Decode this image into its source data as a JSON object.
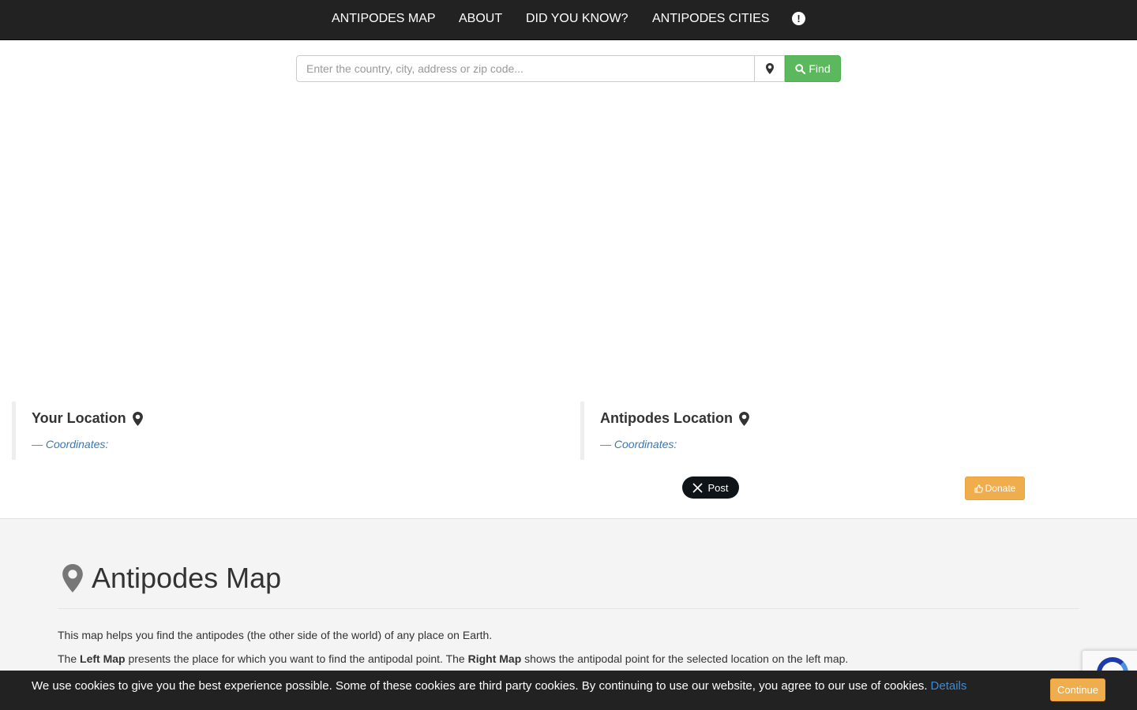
{
  "nav": {
    "items": [
      {
        "label": "ANTIPODES MAP"
      },
      {
        "label": "ABOUT"
      },
      {
        "label": "DID YOU KNOW?"
      },
      {
        "label": "ANTIPODES CITIES"
      }
    ],
    "info_glyph": "!",
    "info_icon": "exclamation-circle-icon"
  },
  "search": {
    "placeholder": "Enter the country, city, address or zip code...",
    "value": "",
    "locate_icon": "map-marker-icon",
    "find_label": "Find",
    "find_icon": "search-icon"
  },
  "your_location": {
    "title": "Your Location",
    "dash": "—",
    "coordinates_label": "Coordinates:",
    "coordinates_value": ""
  },
  "antipodes_location": {
    "title": "Antipodes Location",
    "dash": "—",
    "coordinates_label": "Coordinates:",
    "coordinates_value": ""
  },
  "share": {
    "post_label": "Post"
  },
  "donate": {
    "label": "Donate"
  },
  "content": {
    "heading": "Antipodes Map",
    "para1": "This map helps you find the antipodes (the other side of the world) of any place on Earth.",
    "para2": {
      "t1": "The ",
      "b1": "Left Map",
      "t2": " presents the place for which you want to find the antipodal point. The ",
      "b2": "Right Map",
      "t3": " shows the antipodal point for the selected location on the left map."
    }
  },
  "cookie": {
    "text": "We use cookies to give you the best experience possible. Some of these cookies are third party cookies. By continuing to use our website, you agree to our use of cookies.",
    "details_label": "Details",
    "continue_label": "Continue"
  },
  "colors": {
    "navbar_bg": "#222222",
    "find_green": "#5cb85c",
    "donate_orange": "#f0ad4e",
    "link_blue": "#337ab7",
    "jumbotron_bg": "#f4f4f4"
  }
}
